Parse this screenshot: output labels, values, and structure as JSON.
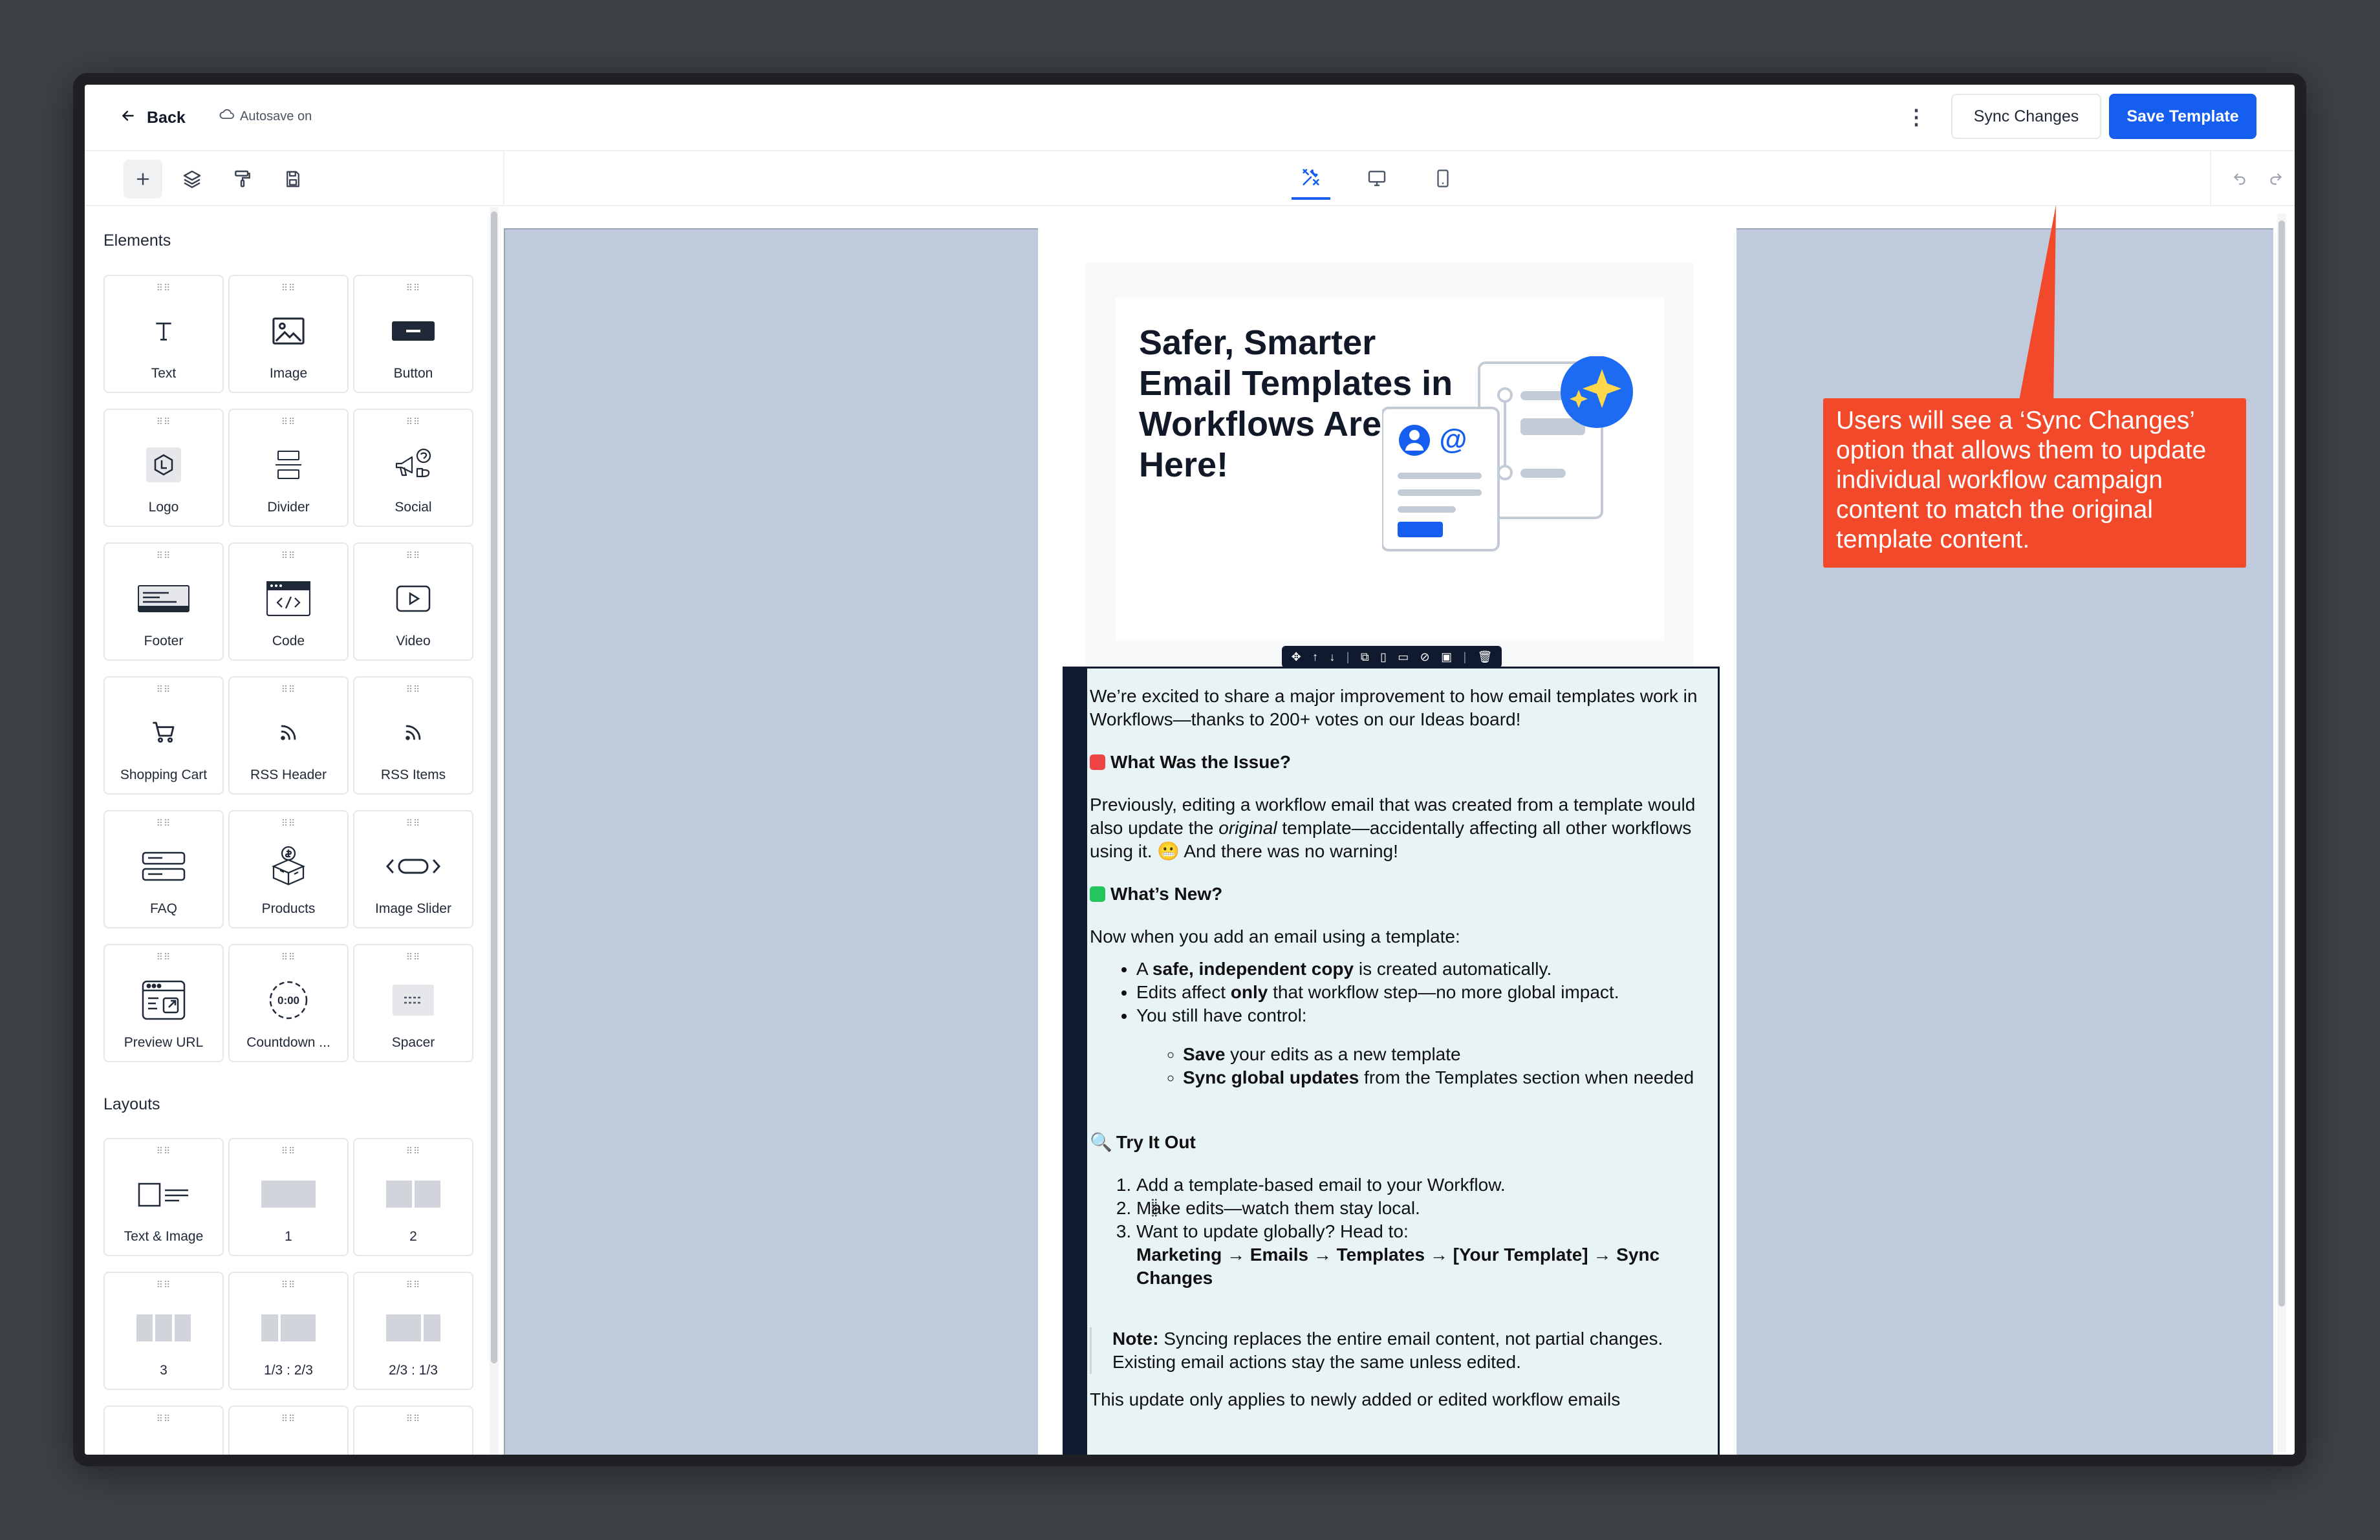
{
  "header": {
    "back_label": "Back",
    "autosave_label": "Autosave on",
    "sync_button": "Sync Changes",
    "save_button": "Save Template"
  },
  "sidebar": {
    "elements_title": "Elements",
    "elements": [
      {
        "label": "Text",
        "icon": "text-icon"
      },
      {
        "label": "Image",
        "icon": "image-icon"
      },
      {
        "label": "Button",
        "icon": "button-icon"
      },
      {
        "label": "Logo",
        "icon": "logo-icon"
      },
      {
        "label": "Divider",
        "icon": "divider-icon"
      },
      {
        "label": "Social",
        "icon": "social-icon"
      },
      {
        "label": "Footer",
        "icon": "footer-icon"
      },
      {
        "label": "Code",
        "icon": "code-icon"
      },
      {
        "label": "Video",
        "icon": "video-icon"
      },
      {
        "label": "Shopping Cart",
        "icon": "shopping-cart-icon"
      },
      {
        "label": "RSS Header",
        "icon": "rss-header-icon"
      },
      {
        "label": "RSS Items",
        "icon": "rss-items-icon"
      },
      {
        "label": "FAQ",
        "icon": "faq-icon"
      },
      {
        "label": "Products",
        "icon": "products-icon"
      },
      {
        "label": "Image Slider",
        "icon": "image-slider-icon"
      },
      {
        "label": "Preview URL",
        "icon": "preview-url-icon"
      },
      {
        "label": "Countdown ...",
        "icon": "countdown-icon"
      },
      {
        "label": "Spacer",
        "icon": "spacer-icon"
      }
    ],
    "layouts_title": "Layouts",
    "layouts": [
      {
        "label": "Text & Image",
        "icon": "text-image-layout-icon"
      },
      {
        "label": "1",
        "icon": "one-column-layout-icon"
      },
      {
        "label": "2",
        "icon": "two-column-layout-icon"
      },
      {
        "label": "3",
        "icon": "three-column-layout-icon"
      },
      {
        "label": "1/3 : 2/3",
        "icon": "one-third-two-thirds-layout-icon"
      },
      {
        "label": "2/3 : 1/3",
        "icon": "two-thirds-one-third-layout-icon"
      }
    ]
  },
  "email": {
    "hero_title": "Safer, Smarter Email Templates in Workflows Are Here!",
    "intro": "We’re excited to share a major improvement to how email templates work in Workflows—thanks to 200+ votes on our Ideas board!",
    "issue_heading": "What Was the Issue?",
    "issue_p1": "Previously, editing a workflow email that was created from a template would also update the ",
    "issue_em": "original",
    "issue_p2": " template—accidentally affecting all other workflows using it. 😬 And there was no warning!",
    "new_heading": "What’s New?",
    "new_intro": "Now when you add an email using a template:",
    "b1_pre": "A ",
    "b1_bold": "safe, independent copy",
    "b1_post": " is created automatically.",
    "b2_pre": "Edits affect ",
    "b2_bold": "only",
    "b2_post": " that workflow step—no more global impact.",
    "b3": "You still have control:",
    "sb1_bold": "Save",
    "sb1_post": " your edits as a new template",
    "sb2_bold": "Sync global updates",
    "sb2_post": " from the Templates section when needed",
    "try_heading": "Try It Out",
    "o1": "Add a template-based email to your Workflow.",
    "o2": "Make edits—watch them stay local.",
    "o3": "Want to update globally? Head to:",
    "o3_path": "Marketing → Emails → Templates → [Your Template] → Sync Changes",
    "note_label": "Note:",
    "note_text": " Syncing replaces the entire email content, not partial changes. Existing email actions stay the same unless edited.",
    "closing": "This update only applies to newly added or edited workflow emails"
  },
  "callout": {
    "text": "Users will see a ‘Sync Changes’ option that allows them to update individual workflow campaign content to match the original template content.",
    "color": "#f2492a"
  },
  "colors": {
    "primary": "#155eef",
    "canvas_bg": "#bfcbdc",
    "selected_block_bg": "#e8f3f5",
    "selection_dark": "#101a2e"
  }
}
